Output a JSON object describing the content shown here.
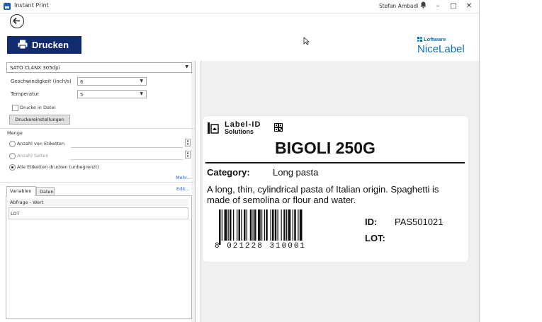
{
  "window": {
    "title": "Instant Print",
    "user": "Stefan Ambadi"
  },
  "toolbar": {
    "print_label": "Drucken"
  },
  "brand": {
    "small": "Loftware",
    "big": "NiceLabel",
    "color": "#0c6fb8"
  },
  "printer": {
    "selected": "SATO CL4NX 305dpi"
  },
  "settings": {
    "speed_label": "Geschwindigkeit (inch/s)",
    "speed_value": "6",
    "temperature_label": "Temperatur",
    "temperature_value": "5",
    "print_to_file_label": "Drucke in Datei",
    "printer_settings_button": "Druckereinstellungen"
  },
  "quantity": {
    "section_label": "Menge",
    "option_labels": "Anzahl von Etiketten",
    "option_pages": "Anzahl Seiten",
    "option_all": "Alle Etiketten drucken (unbegrenzt)",
    "more_link": "Mehr..."
  },
  "variables": {
    "tab_variables": "Variablen",
    "tab_data": "Daten",
    "edit_link": "Edit...",
    "column_header": "Abfrage - Wert",
    "rows": [
      "LOT"
    ]
  },
  "label": {
    "logo_line1": "Label-ID",
    "logo_line2": "Solutions",
    "title": "BIGOLI 250G",
    "category_key": "Category:",
    "category_value": "Long pasta",
    "description": "A long, thin, cylindrical pasta of Italian origin. Spaghetti is made of semolina or flour and water.",
    "barcode_digits": "8 021228 310001",
    "id_key": "ID:",
    "id_value": "PAS501021",
    "lot_key": "LOT:"
  },
  "colors": {
    "accent": "#122a6e",
    "preview_bg": "#f0f0f0"
  }
}
